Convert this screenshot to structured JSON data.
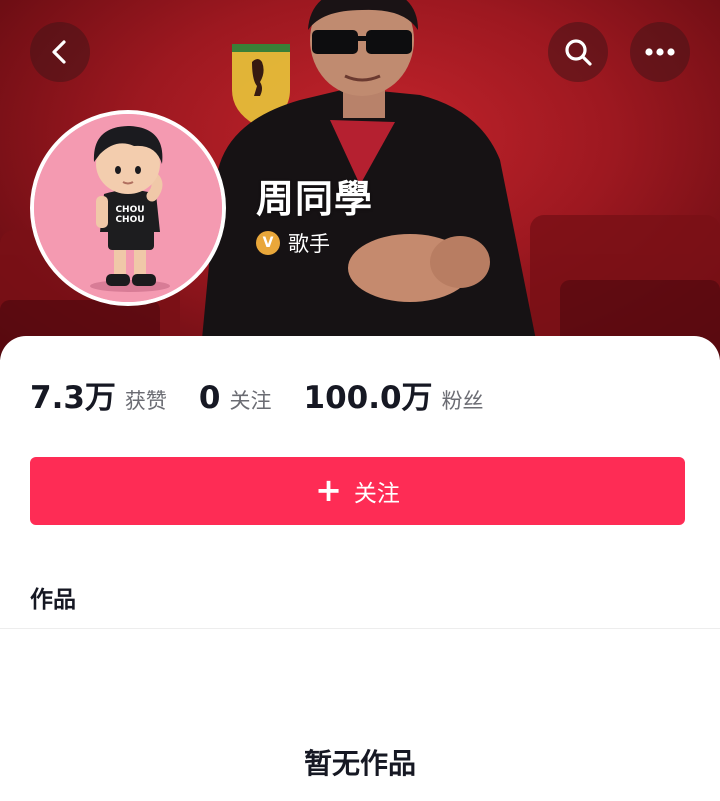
{
  "profile": {
    "name": "周同學",
    "verified_label": "歌手",
    "verified_badge_letter": "V"
  },
  "stats": [
    {
      "value": "7.3万",
      "label": "获赞"
    },
    {
      "value": "0",
      "label": "关注"
    },
    {
      "value": "100.0万",
      "label": "粉丝"
    }
  ],
  "follow_button": {
    "icon": "+",
    "label": "关注"
  },
  "works": {
    "title": "作品",
    "empty_text": "暂无作品"
  },
  "avatar_figure": {
    "shirt_text": [
      "CHOU",
      "CHOU"
    ]
  },
  "icons": {
    "back": "chevron-left-icon",
    "search": "search-icon",
    "more": "more-horizontal-icon"
  },
  "colors": {
    "accent": "#fe2c55",
    "header_red": "#9d1820",
    "badge_gold": "#e9a73a",
    "avatar_bg": "#f49ab1"
  }
}
